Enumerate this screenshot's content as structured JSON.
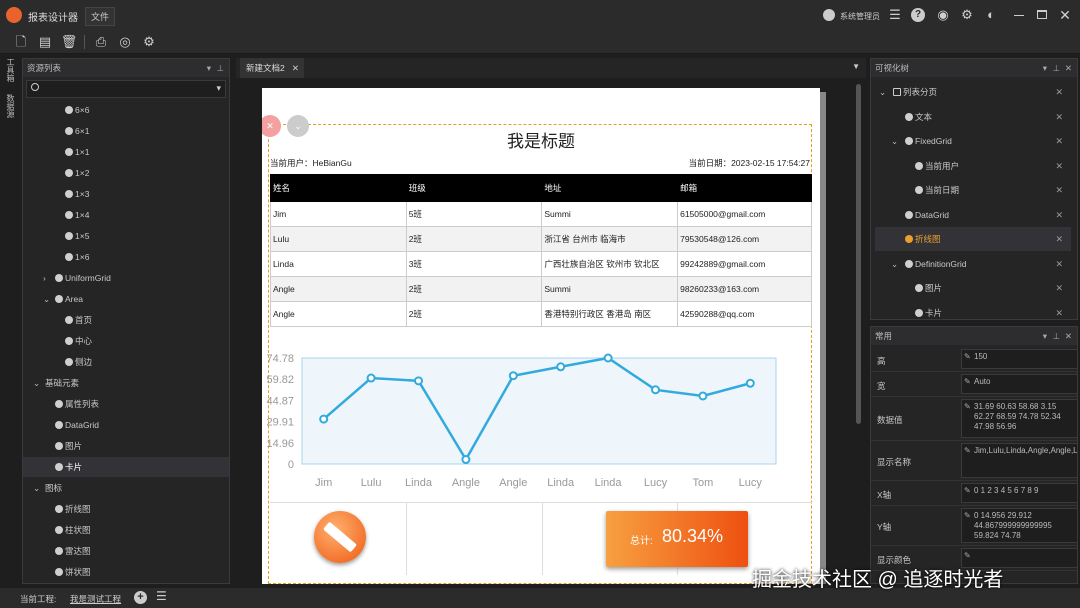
{
  "app": {
    "title": "报表设计器",
    "menu_file": "文件",
    "user": "系统管理员"
  },
  "left_panel": {
    "tab_vertical_1": "工具箱",
    "tab_vertical_2": "数据源",
    "title": "资源列表",
    "search_placeholder": "",
    "items": [
      {
        "label": "6×6",
        "level": 3
      },
      {
        "label": "6×1",
        "level": 3
      },
      {
        "label": "1×1",
        "level": 3
      },
      {
        "label": "1×2",
        "level": 3
      },
      {
        "label": "1×3",
        "level": 3
      },
      {
        "label": "1×4",
        "level": 3
      },
      {
        "label": "1×5",
        "level": 3
      },
      {
        "label": "1×6",
        "level": 3
      },
      {
        "label": "UniformGrid",
        "level": 2,
        "arrow": "›"
      },
      {
        "label": "Area",
        "level": 2,
        "arrow": "⌄"
      },
      {
        "label": "首页",
        "level": 3
      },
      {
        "label": "中心",
        "level": 3
      },
      {
        "label": "侧边",
        "level": 3
      },
      {
        "label": "基础元素",
        "level": 1,
        "arrow": "⌄",
        "nodot": true
      },
      {
        "label": "属性列表",
        "level": 2
      },
      {
        "label": "DataGrid",
        "level": 2
      },
      {
        "label": "图片",
        "level": 2
      },
      {
        "label": "卡片",
        "level": 2,
        "selected": true
      },
      {
        "label": "图标",
        "level": 1,
        "arrow": "⌄",
        "nodot": true
      },
      {
        "label": "折线图",
        "level": 2
      },
      {
        "label": "柱状图",
        "level": 2
      },
      {
        "label": "雷达图",
        "level": 2
      },
      {
        "label": "饼状图",
        "level": 2
      }
    ]
  },
  "document": {
    "tab_label": "新建文档2",
    "report_title": "我是标题",
    "current_user": "当前用户：HeBianGu",
    "current_date": "当前日期：2023-02-15 17:54:27",
    "columns": [
      "姓名",
      "班级",
      "地址",
      "邮箱"
    ],
    "rows": [
      [
        "Jim",
        "5班",
        "Summi",
        "61505000@gmail.com"
      ],
      [
        "Lulu",
        "2班",
        "浙江省 台州市 临海市",
        "79530548@126.com"
      ],
      [
        "Linda",
        "3班",
        "广西壮族自治区 钦州市 钦北区",
        "99242889@gmail.com"
      ],
      [
        "Angle",
        "2班",
        "Summi",
        "98260233@163.com"
      ],
      [
        "Angle",
        "2班",
        "香港特别行政区 香港岛 南区",
        "42590288@qq.com"
      ]
    ],
    "card_label": "总计:",
    "card_value": "80.34%"
  },
  "chart_data": {
    "type": "line",
    "categories": [
      "Jim",
      "Lulu",
      "Linda",
      "Angle",
      "Angle",
      "Linda",
      "Linda",
      "Lucy",
      "Tom",
      "Lucy"
    ],
    "values": [
      31.69,
      60.63,
      58.68,
      3.15,
      62.27,
      68.59,
      74.78,
      52.34,
      47.98,
      56.96
    ],
    "yticks": [
      "74.78",
      "59.82",
      "44.87",
      "29.91",
      "14.96",
      "0"
    ],
    "ylim": [
      0,
      74.78
    ],
    "color": "#33aadd"
  },
  "visual_tree": {
    "title": "可视化树",
    "items": [
      {
        "label": "列表分页",
        "level": 1,
        "arrow": "⌄",
        "icon": "▭"
      },
      {
        "label": "文本",
        "level": 2
      },
      {
        "label": "FixedGrid",
        "level": 2,
        "arrow": "⌄"
      },
      {
        "label": "当前用户",
        "level": 3
      },
      {
        "label": "当前日期",
        "level": 3
      },
      {
        "label": "DataGrid",
        "level": 2
      },
      {
        "label": "折线图",
        "level": 2,
        "selected": true
      },
      {
        "label": "DefinitionGrid",
        "level": 2,
        "arrow": "⌄"
      },
      {
        "label": "图片",
        "level": 3
      },
      {
        "label": "卡片",
        "level": 3
      }
    ]
  },
  "properties": {
    "title": "常用",
    "rows": [
      {
        "label": "高",
        "value": "150"
      },
      {
        "label": "宽",
        "value": "Auto"
      },
      {
        "label": "数据值",
        "value": "31.69   60.63   58.68   3.15   62.27   68.59   74.78   52.34   47.98   56.96"
      },
      {
        "label": "显示名称",
        "value": "Jim,Lulu,Linda,Angle,Angle,Linda,Linda,Lucy,Tom,Lucy"
      },
      {
        "label": "X轴",
        "value": "0 1 2 3 4 5 6 7 8 9"
      },
      {
        "label": "Y轴",
        "value": "0   14.956   29.912   44.867999999999995   59.824   74.78"
      },
      {
        "label": "显示颜色",
        "value": ""
      }
    ]
  },
  "status": {
    "label": "当前工程:",
    "project": "我是测试工程"
  },
  "watermark": "掘金技术社区 @ 追逐时光者"
}
